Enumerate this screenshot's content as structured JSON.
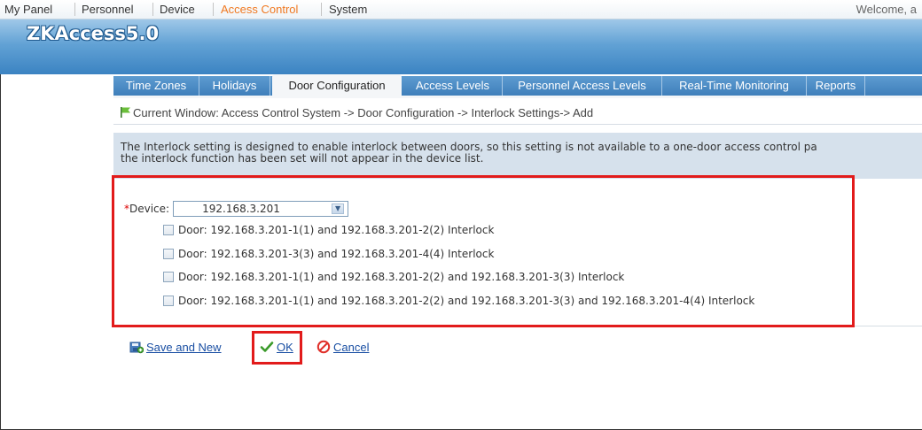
{
  "topmenu": {
    "items": [
      "My Panel",
      "Personnel",
      "Device",
      "Access Control",
      "System"
    ],
    "active_index": 3,
    "welcome": "Welcome, a"
  },
  "banner": {
    "logo": "ZKAccess5.0"
  },
  "tabs": {
    "items": [
      "Time Zones",
      "Holidays",
      "Door Configuration",
      "Access Levels",
      "Personnel Access Levels",
      "Real-Time Monitoring",
      "Reports"
    ],
    "active_index": 2
  },
  "breadcrumb": "Current Window: Access Control System -> Door Configuration -> Interlock Settings-> Add",
  "info": {
    "line1": "The Interlock setting is designed to enable interlock between doors, so this setting is not available to a one-door access control pa",
    "line2": "the interlock function has been set will not appear in the device list."
  },
  "form": {
    "required_mark": "*",
    "device_label": "Device:",
    "device_value": "192.168.3.201",
    "options": [
      "Door: 192.168.3.201-1(1) and 192.168.3.201-2(2) Interlock",
      "Door: 192.168.3.201-3(3) and 192.168.3.201-4(4) Interlock",
      "Door: 192.168.3.201-1(1) and 192.168.3.201-2(2) and 192.168.3.201-3(3) Interlock",
      "Door: 192.168.3.201-1(1) and 192.168.3.201-2(2) and 192.168.3.201-3(3) and 192.168.3.201-4(4) Interlock"
    ]
  },
  "actions": {
    "save_new": "Save and New",
    "ok": "OK",
    "cancel": "Cancel"
  },
  "colors": {
    "highlight": "#e21b1b",
    "active_menu": "#f07820",
    "tab_bar": "#3f7fbb",
    "link": "#1a4fa3"
  }
}
